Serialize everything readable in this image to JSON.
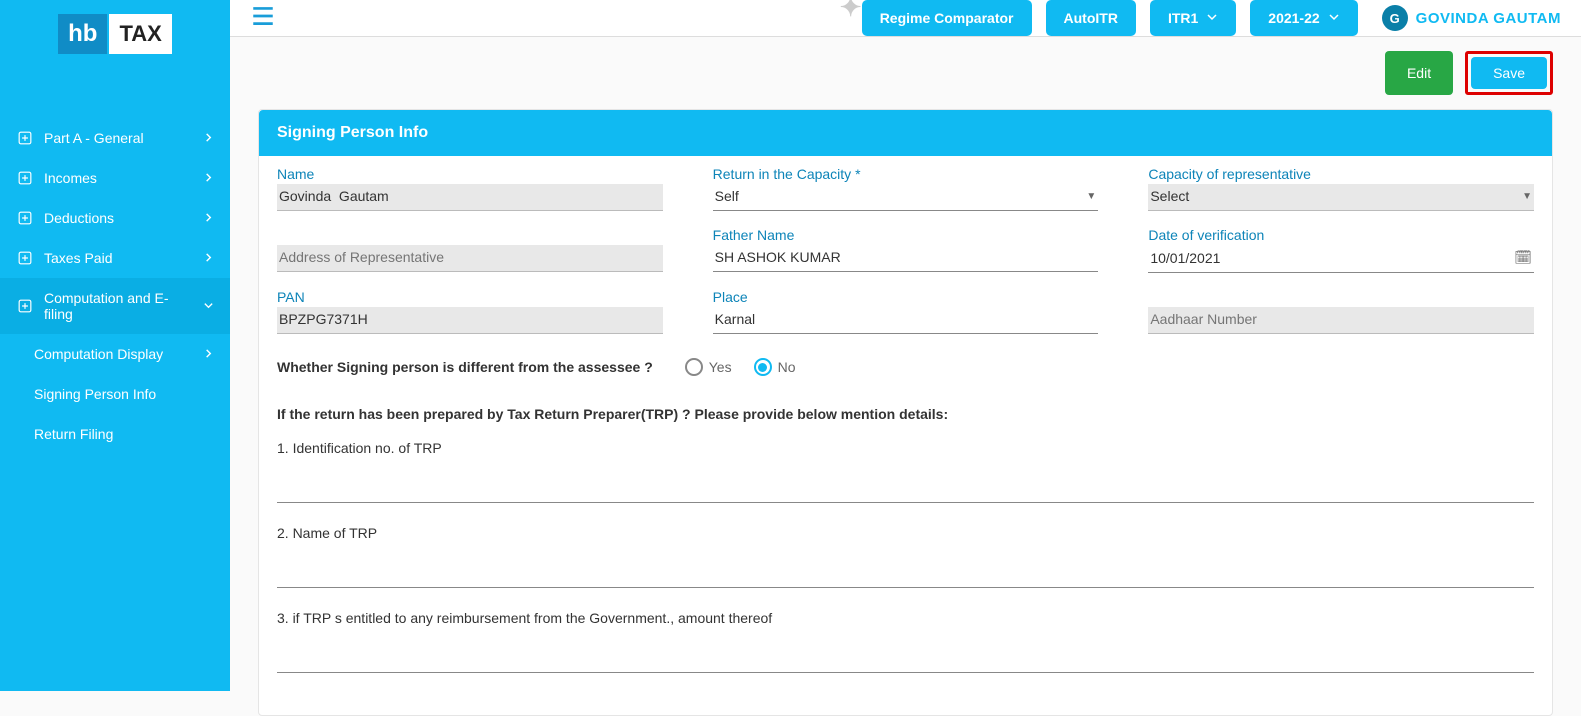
{
  "logo": {
    "hb": "hb",
    "tax": "TAX"
  },
  "sidebar": {
    "items": [
      {
        "label": "Part A - General",
        "hasPlus": true,
        "chev": "right"
      },
      {
        "label": "Incomes",
        "hasPlus": true,
        "chev": "right"
      },
      {
        "label": "Deductions",
        "hasPlus": true,
        "chev": "right"
      },
      {
        "label": "Taxes Paid",
        "hasPlus": true,
        "chev": "right"
      },
      {
        "label": "Computation and E-filing",
        "hasPlus": true,
        "chev": "down"
      }
    ],
    "subs": [
      {
        "label": "Computation Display",
        "chev": "right"
      },
      {
        "label": "Signing Person Info"
      },
      {
        "label": "Return Filing"
      }
    ]
  },
  "topbar": {
    "regime": "Regime Comparator",
    "newBadge": "New",
    "autoitr": "AutoITR",
    "itr": "ITR1",
    "year": "2021-22",
    "userInitial": "G",
    "userName": "GOVINDA GAUTAM"
  },
  "actions": {
    "edit": "Edit",
    "save": "Save"
  },
  "panel": {
    "title": "Signing Person Info",
    "fields": {
      "name_label": "Name",
      "name_value": "Govinda  Gautam",
      "return_capacity_label": "Return in the Capacity *",
      "return_capacity_value": "Self",
      "rep_capacity_label": "Capacity of representative",
      "rep_capacity_value": "Select",
      "rep_address_placeholder": "Address of Representative",
      "father_label": "Father Name",
      "father_value": "SH ASHOK KUMAR",
      "dov_label": "Date of verification",
      "dov_value": "10/01/2021",
      "pan_label": "PAN",
      "pan_value": "BPZPG7371H",
      "place_label": "Place",
      "place_value": "Karnal",
      "aadhaar_placeholder": "Aadhaar Number"
    },
    "radio": {
      "question": "Whether Signing person is different from the assessee ?",
      "yes": "Yes",
      "no": "No",
      "selected": "no"
    },
    "trp": {
      "title": "If the return has been prepared by Tax Return Preparer(TRP) ? Please provide below mention details:",
      "q1": "1. Identification no. of TRP",
      "q2": "2. Name of TRP",
      "q3": "3. if TRP s entitled to any reimbursement from the Government., amount thereof"
    }
  }
}
